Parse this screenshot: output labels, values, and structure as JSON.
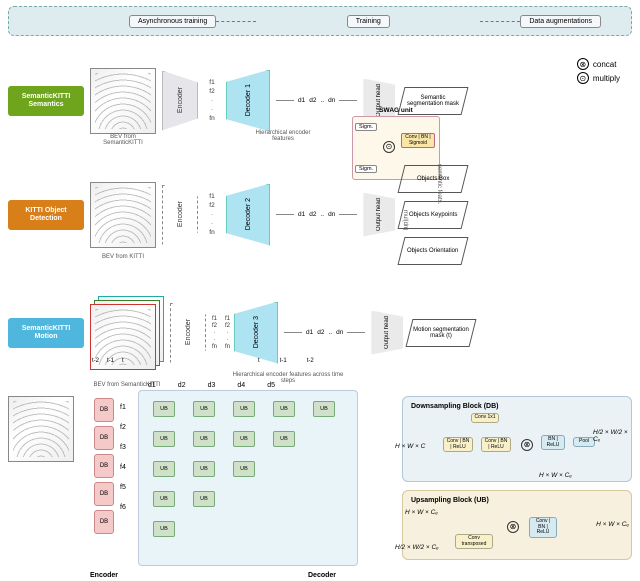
{
  "top_bar": {
    "async": "Asynchronous training",
    "training": "Training",
    "augment": "Data augmentations"
  },
  "legend": {
    "concat_sym": "⊗",
    "concat": "concat",
    "multiply_sym": "⊙",
    "multiply": "multiply"
  },
  "streams": {
    "s1": {
      "label": "SemanticKITTI\nSemantics",
      "bev_caption": "BEV from SemanticKITTI"
    },
    "s2": {
      "label": "KITTI\nObject Detection",
      "bev_caption": "BEV from KITTI"
    },
    "s3": {
      "label": "SemanticKITTI\nMotion",
      "bev_caption": "BEV from SemanticKITTI",
      "t_labels": [
        "t-2",
        "t-1",
        "t"
      ]
    }
  },
  "encoder": {
    "label": "Encoder",
    "feat_caption": "Hierarchical encoder features"
  },
  "feats": [
    "f1",
    "f2",
    "·",
    "·",
    "fn"
  ],
  "decoders": {
    "d1": "Decoder 1",
    "d2": "Decoder 2",
    "d3": "Decoder 3",
    "feat_caption3": "Hierarchical encoder features across time steps",
    "time_cols": [
      "t",
      "t-1",
      "t-2"
    ]
  },
  "d_outs": [
    "d1",
    "d2",
    "..",
    "dn"
  ],
  "head": "Output head",
  "outputs": {
    "seg": "Semantic segmentation mask",
    "box": "Objects Box",
    "kp": "Objects Keypoints",
    "orient": "Objects Orientation",
    "motion": "Motion segmentation mask (t)"
  },
  "swag": {
    "title": "SWAG unit",
    "sigm": "Sigm.",
    "conv": "Conv | BN | Sigmoid",
    "sem_feats": "semantic feats.",
    "mul_din": "mul(dn)"
  },
  "bottom": {
    "encoder_caption": "Encoder",
    "decoder_caption": "Decoder",
    "db": "DB",
    "ub": "UB",
    "f_labels": [
      "f1",
      "f2",
      "f3",
      "f4",
      "f5",
      "f6"
    ],
    "d_labels": [
      "d1",
      "d2",
      "d3",
      "d4",
      "d5"
    ]
  },
  "panels": {
    "ds": {
      "title": "Downsampling Block (DB)",
      "in_dim": "H × W × C",
      "out_dim_top": "H/2 × W/2 × Cₑ",
      "out_dim_side": "H × W × Cₑ",
      "conv1x1": "Conv 1x1",
      "convbnrelu": "Conv | BN | ReLU",
      "bnrelu": "BN | ReLU",
      "pool": "Pool"
    },
    "us": {
      "title": "Upsampling Block (UB)",
      "in_top": "H × W × Cₑ",
      "in_bottom": "H/2 × W/2 × Cₑ",
      "out": "H × W × Cₑ",
      "convtrans": "Conv transposed",
      "convbnrelu": "Conv | BN | ReLU"
    }
  },
  "ops": {
    "concat": "⊗",
    "mul": "⊙"
  }
}
